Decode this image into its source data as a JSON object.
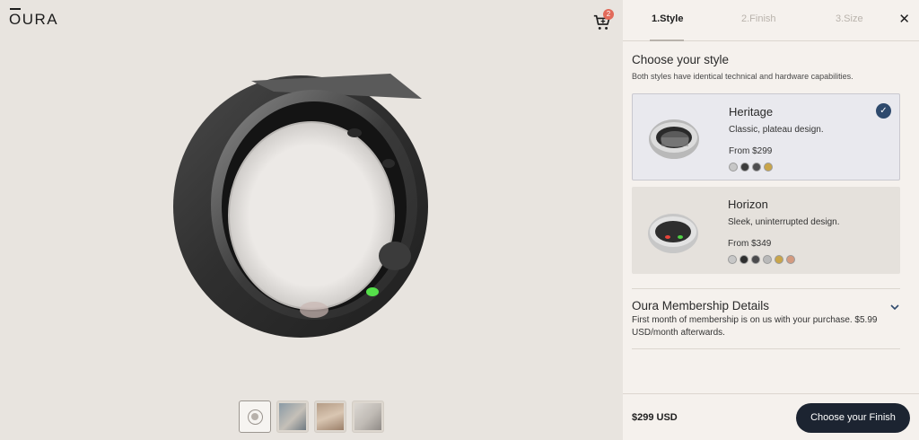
{
  "header": {
    "logo_text": "OURA",
    "cart_count": "2",
    "cart_icon": "cart-icon"
  },
  "product_view": {
    "thumbnails": [
      {
        "kind": "3d-view",
        "icon": "rotate-3d-icon"
      },
      {
        "kind": "image"
      },
      {
        "kind": "image"
      },
      {
        "kind": "image"
      }
    ]
  },
  "steps": [
    {
      "label": "1.Style",
      "active": true
    },
    {
      "label": "2.Finish",
      "active": false
    },
    {
      "label": "3.Size",
      "active": false
    }
  ],
  "close_icon": "close-icon",
  "style_section": {
    "title": "Choose your style",
    "subtitle": "Both styles have identical technical and hardware capabilities.",
    "options": [
      {
        "name": "Heritage",
        "description": "Classic, plateau design.",
        "price": "From $299",
        "selected": true,
        "swatches": [
          "#c7c7c7",
          "#3b3b3b",
          "#4e4e50",
          "#c9a54a"
        ]
      },
      {
        "name": "Horizon",
        "description": "Sleek, uninterrupted design.",
        "price": "From $349",
        "selected": false,
        "swatches": [
          "#c7c7c7",
          "#2e2e2e",
          "#4a4a4c",
          "#b9b9b9",
          "#c9a54a",
          "#d49a7f"
        ]
      }
    ]
  },
  "membership": {
    "title": "Oura Membership Details",
    "text": "First month of membership is on us with your purchase. $5.99 USD/month afterwards."
  },
  "footer": {
    "total": "$299 USD",
    "cta_label": "Choose your Finish"
  },
  "colors": {
    "accent_navy": "#1c2431",
    "check_blue": "#2f4a6d",
    "badge_red": "#e26a5a"
  }
}
